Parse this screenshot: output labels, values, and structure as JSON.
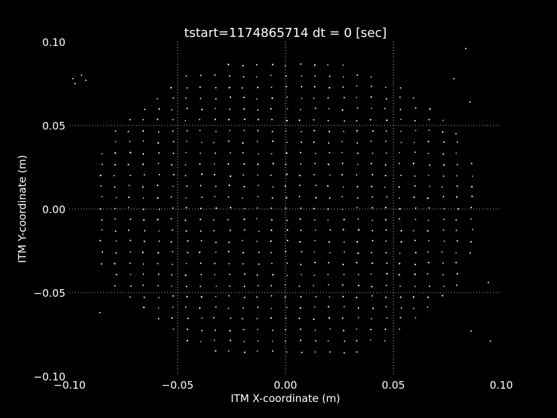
{
  "chart_data": {
    "type": "scatter",
    "title": "tstart=1174865714 dt = 0 [sec]",
    "xlabel": "ITM X-coordinate (m)",
    "ylabel": "ITM Y-coordinate (m)",
    "xlim": [
      -0.1,
      0.1
    ],
    "ylim": [
      -0.1,
      0.1
    ],
    "xticks": [
      -0.1,
      -0.05,
      0.0,
      0.05,
      0.1
    ],
    "yticks": [
      -0.1,
      -0.05,
      0.0,
      0.05,
      0.1
    ],
    "xtick_labels": [
      "−0.10",
      "−0.05",
      "0.00",
      "0.05",
      "0.10"
    ],
    "ytick_labels": [
      "−0.10",
      "−0.05",
      "0.00",
      "0.05",
      "0.10"
    ],
    "grid": true,
    "background_color": "#000000",
    "foreground_color": "#ffffff",
    "grid_pitch": 0.0066,
    "grid_radius": 0.092,
    "extra_points": [
      {
        "x": -0.0985,
        "y": 0.078
      },
      {
        "x": -0.0975,
        "y": 0.075
      },
      {
        "x": -0.0945,
        "y": 0.08
      },
      {
        "x": -0.0925,
        "y": 0.077
      },
      {
        "x": 0.0835,
        "y": 0.096
      },
      {
        "x": 0.0855,
        "y": 0.064
      },
      {
        "x": 0.078,
        "y": 0.078
      },
      {
        "x": 0.086,
        "y": -0.073
      },
      {
        "x": 0.095,
        "y": -0.079
      },
      {
        "x": 0.094,
        "y": -0.044
      },
      {
        "x": 0.079,
        "y": 0.045
      },
      {
        "x": -0.086,
        "y": -0.062
      }
    ]
  }
}
